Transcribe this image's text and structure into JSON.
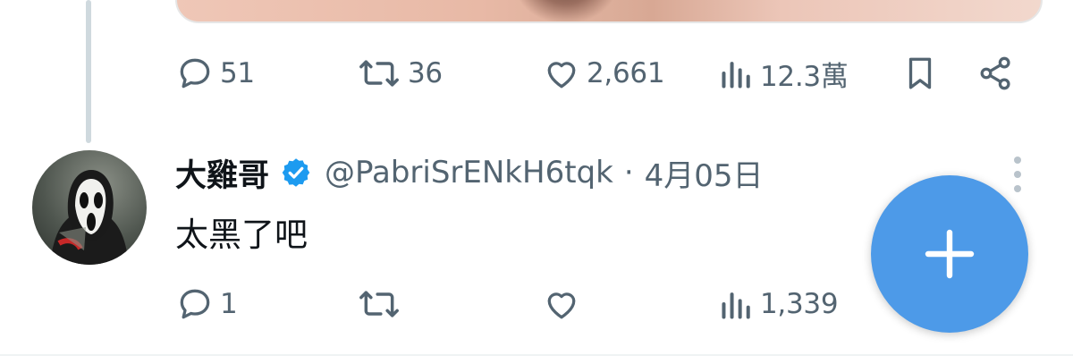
{
  "previous_post": {
    "actions": {
      "reply_count": "51",
      "retweet_count": "36",
      "like_count": "2,661",
      "view_count": "12.3萬"
    }
  },
  "reply_post": {
    "display_name": "大雞哥",
    "handle": "@PabriSrENkH6tqk",
    "separator": "·",
    "date": "4月05日",
    "text": "太黑了吧",
    "actions": {
      "reply_count": "1",
      "retweet_count": "",
      "like_count": "",
      "view_count": "1,339"
    }
  },
  "colors": {
    "accent": "#4d9ae8",
    "verified": "#1d9bf0",
    "icon_gray": "#536471",
    "thread_line": "#cfd9de"
  },
  "icons": [
    "reply-icon",
    "retweet-icon",
    "like-icon",
    "views-icon",
    "bookmark-icon",
    "share-icon",
    "verified-badge-icon",
    "more-icon",
    "compose-plus-icon"
  ]
}
